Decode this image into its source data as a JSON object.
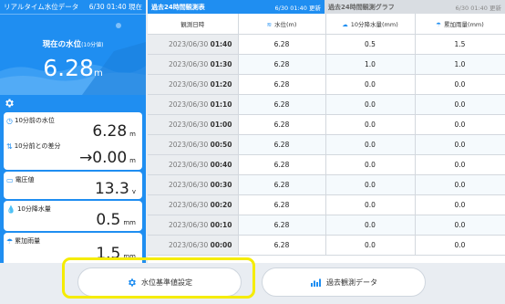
{
  "left_panel": {
    "header_title": "リアルタイム水位データ",
    "header_time": "6/30 01:40 現在",
    "hero_title": "現在の水位",
    "hero_sub": "(10分値)",
    "hero_value": "6.28",
    "hero_unit": "m",
    "cards": [
      {
        "label": "10分前の水位",
        "value": "6.28",
        "unit": "m",
        "icon": "clock-icon"
      },
      {
        "label": "10分前との差分",
        "value": "→0.00",
        "unit": "m",
        "icon": "arrows-updown-icon"
      },
      {
        "label": "電圧値",
        "value": "13.3",
        "unit": "v",
        "icon": "battery-icon"
      },
      {
        "label": "10分降水量",
        "value": "0.5",
        "unit": "mm",
        "icon": "rain-drop-icon"
      },
      {
        "label": "累加雨量",
        "value": "1.5",
        "unit": "mm",
        "icon": "umbrella-icon"
      }
    ]
  },
  "tabs": [
    {
      "label": "過去24時間観測表",
      "time": "6/30 01:40 更新"
    },
    {
      "label": "過去24時間観測グラフ",
      "time": "6/30 01:40 更新"
    }
  ],
  "table": {
    "headers": [
      "観測日時",
      "水位(m)",
      "10分降水量(mm)",
      "累加雨量(mm)"
    ],
    "rows": [
      {
        "date": "2023/06/30",
        "time": "01:40",
        "level": "6.28",
        "rain10": "0.5",
        "cum": "1.5"
      },
      {
        "date": "2023/06/30",
        "time": "01:30",
        "level": "6.28",
        "rain10": "1.0",
        "cum": "1.0"
      },
      {
        "date": "2023/06/30",
        "time": "01:20",
        "level": "6.28",
        "rain10": "0.0",
        "cum": "0.0"
      },
      {
        "date": "2023/06/30",
        "time": "01:10",
        "level": "6.28",
        "rain10": "0.0",
        "cum": "0.0"
      },
      {
        "date": "2023/06/30",
        "time": "01:00",
        "level": "6.28",
        "rain10": "0.0",
        "cum": "0.0"
      },
      {
        "date": "2023/06/30",
        "time": "00:50",
        "level": "6.28",
        "rain10": "0.0",
        "cum": "0.0"
      },
      {
        "date": "2023/06/30",
        "time": "00:40",
        "level": "6.28",
        "rain10": "0.0",
        "cum": "0.0"
      },
      {
        "date": "2023/06/30",
        "time": "00:30",
        "level": "6.28",
        "rain10": "0.0",
        "cum": "0.0"
      },
      {
        "date": "2023/06/30",
        "time": "00:20",
        "level": "6.28",
        "rain10": "0.0",
        "cum": "0.0"
      },
      {
        "date": "2023/06/30",
        "time": "00:10",
        "level": "6.28",
        "rain10": "0.0",
        "cum": "0.0"
      },
      {
        "date": "2023/06/30",
        "time": "00:00",
        "level": "6.28",
        "rain10": "0.0",
        "cum": "0.0"
      }
    ]
  },
  "buttons": {
    "settings": "水位基準値設定",
    "history": "過去観測データ"
  },
  "colors": {
    "accent": "#1f8ef1",
    "highlight": "#f5ec00"
  }
}
